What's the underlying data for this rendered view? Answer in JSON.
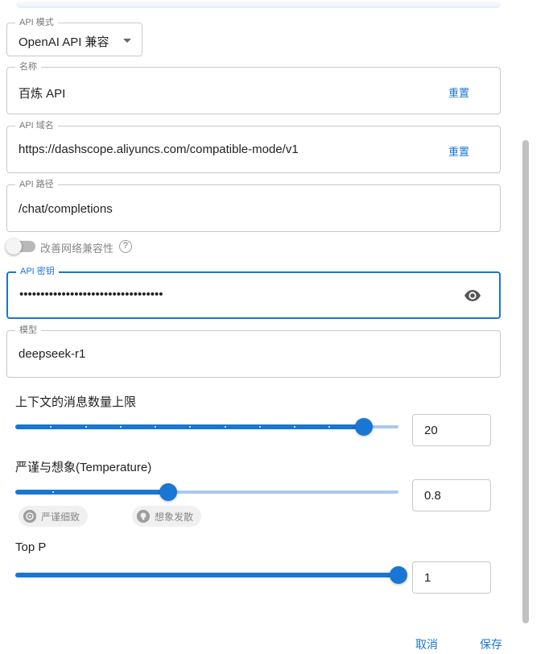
{
  "form": {
    "api_mode": {
      "label": "API 模式",
      "value": "OpenAI API 兼容"
    },
    "name": {
      "label": "名称",
      "value": "百炼 API",
      "reset_label": "重置"
    },
    "api_host": {
      "label": "API 域名",
      "value": "https://dashscope.aliyuncs.com/compatible-mode/v1",
      "reset_label": "重置"
    },
    "api_path": {
      "label": "API 路径",
      "value": "/chat/completions"
    },
    "network_compat": {
      "label": "改善网络兼容性",
      "help_icon": "help-circle-icon",
      "enabled": false
    },
    "api_key": {
      "label": "API 密钥",
      "value": "••••••••••••••••••••••••••••••••••",
      "visibility_icon": "eye-icon"
    },
    "model": {
      "label": "模型",
      "value": "deepseek-r1"
    }
  },
  "settings": {
    "context_limit": {
      "title": "上下文的消息数量上限",
      "value": "20",
      "level": 0.91
    },
    "temperature": {
      "title": "严谨与想象(Temperature)",
      "value": "0.8",
      "level": 0.4,
      "chips": [
        {
          "label": "严谨细致",
          "icon": "target-icon"
        },
        {
          "label": "想象发散",
          "icon": "lightbulb-icon"
        }
      ]
    },
    "top_p": {
      "title": "Top P",
      "value": "1",
      "level": 1.0
    }
  },
  "footer": {
    "cancel_label": "取消",
    "save_label": "保存"
  },
  "colors": {
    "accent": "#1976d2",
    "rail": "#a9c9ec",
    "border": "#c8c8c8"
  }
}
